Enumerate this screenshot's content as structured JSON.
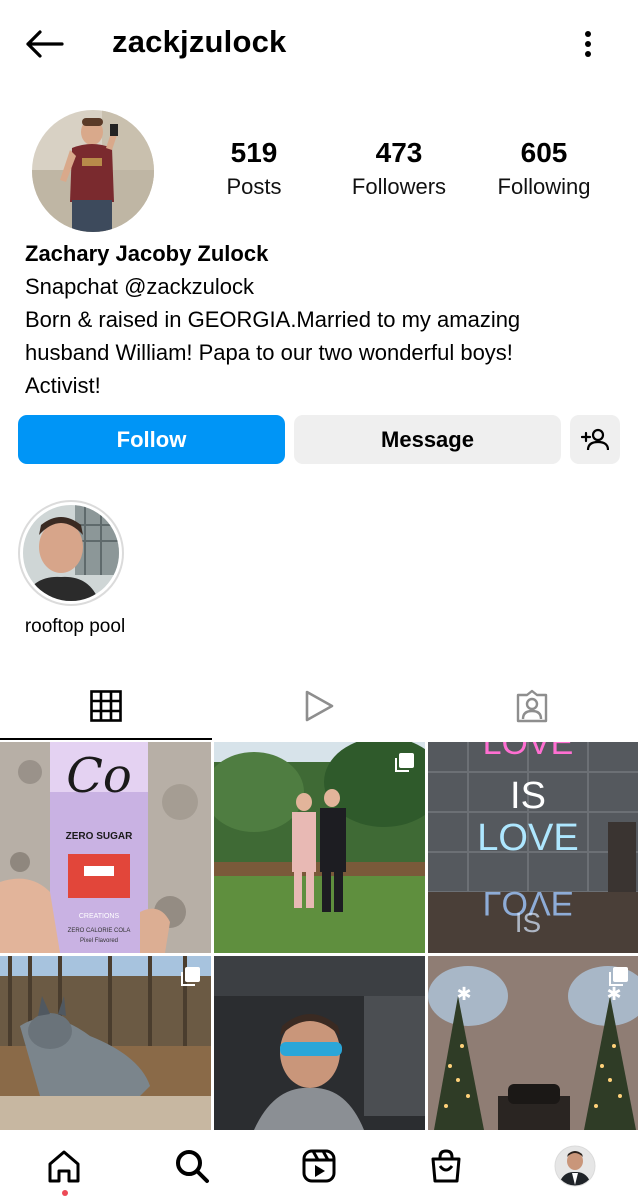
{
  "header": {
    "username": "zackjzulock",
    "back_icon": "arrow-left-icon",
    "more_icon": "kebab-icon"
  },
  "profile": {
    "stats": [
      {
        "value": "519",
        "label": "Posts"
      },
      {
        "value": "473",
        "label": "Followers"
      },
      {
        "value": "605",
        "label": "Following"
      }
    ],
    "full_name": "Zachary Jacoby Zulock",
    "bio_lines": [
      "Snapchat @zackzulock",
      "Born & raised in GEORGIA.Married to my amazing",
      "husband William! Papa to our two wonderful boys!",
      "Activist!"
    ]
  },
  "actions": {
    "follow_label": "Follow",
    "message_label": "Message",
    "add_user_icon": "add-person-icon"
  },
  "highlights": [
    {
      "label": "rooftop pool"
    }
  ],
  "tabs": [
    {
      "icon": "grid-icon",
      "active": true
    },
    {
      "icon": "reels-play-icon",
      "active": false
    },
    {
      "icon": "tagged-person-icon",
      "active": false
    }
  ],
  "grid_images": {
    "img1": {
      "text_main": "ZERO SUGAR",
      "text_creations": "CREATIONS",
      "text_cal": "ZERO CALORIE COLA",
      "text_flavor": "Pixel Flavored"
    },
    "img3": {
      "line1": "LOVE",
      "line2": "IS",
      "line3": "LOVE",
      "line4": "LOVE",
      "line5": "IS"
    }
  },
  "bottom_nav": [
    {
      "icon": "home-icon"
    },
    {
      "icon": "search-icon"
    },
    {
      "icon": "reels-icon"
    },
    {
      "icon": "shop-icon"
    },
    {
      "icon": "profile-avatar"
    }
  ],
  "colors": {
    "accent": "#0095f6",
    "button_bg": "#efefef",
    "notification_dot": "#ed4956"
  }
}
